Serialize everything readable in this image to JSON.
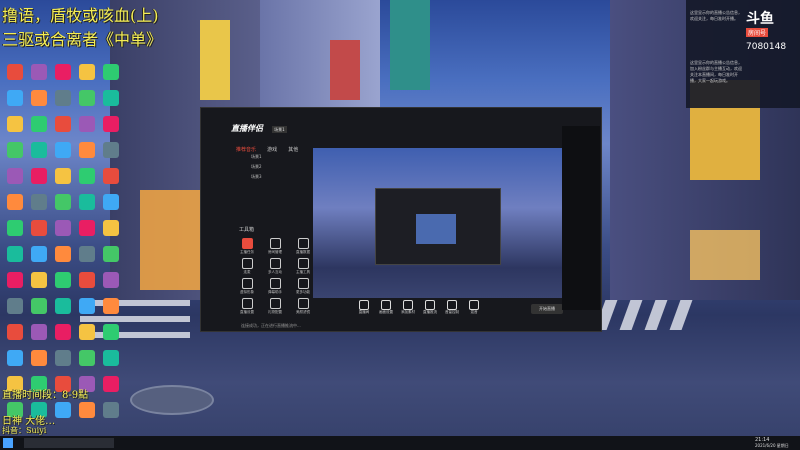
{
  "overlay": {
    "line1": "撸语，盾牧或咳血(上)",
    "line2": "三驱或合离者《中单》",
    "stream_time": "直播时间段：8-9點",
    "bottom_cut": "日神 大佬…",
    "bottom_cut2": "抖音：Suiyi"
  },
  "douyu": {
    "logo": "斗鱼",
    "sublabel": "房间号",
    "room_id": "7080148"
  },
  "notice": {
    "text": "这里显示你的直播公告信息，加入粉丝群与主播互动，欢迎关注本直播间，每日准时开播，大家一起玩游戏。"
  },
  "notice2": {
    "text": "这里显示你的直播公告信息，欢迎关注，每日准时开播。"
  },
  "app": {
    "title": "直播伴侣",
    "tab_scene": "场景1",
    "left_tabs": [
      "推荐音乐",
      "游戏",
      "其他"
    ],
    "scenes": [
      "场景1",
      "场景2",
      "场景3"
    ],
    "tools_title": "工具箱",
    "tools": [
      "主播任务",
      "房间管理",
      "直播数据",
      "连麦",
      "多人互动",
      "主播工具",
      "虚拟形象",
      "弹幕助手",
      "更多功能",
      "直播设置",
      "礼物配置",
      "美颜滤镜"
    ],
    "bottom_buttons": [
      "直播间",
      "画面设置",
      "添加素材",
      "直播推流",
      "音量控制",
      "混音"
    ],
    "start_button": "开始直播",
    "footer_note": "连接成功，正在进行直播推流中..."
  },
  "taskbar": {
    "time": "21:14",
    "date": "2021/6/20 星期日"
  }
}
